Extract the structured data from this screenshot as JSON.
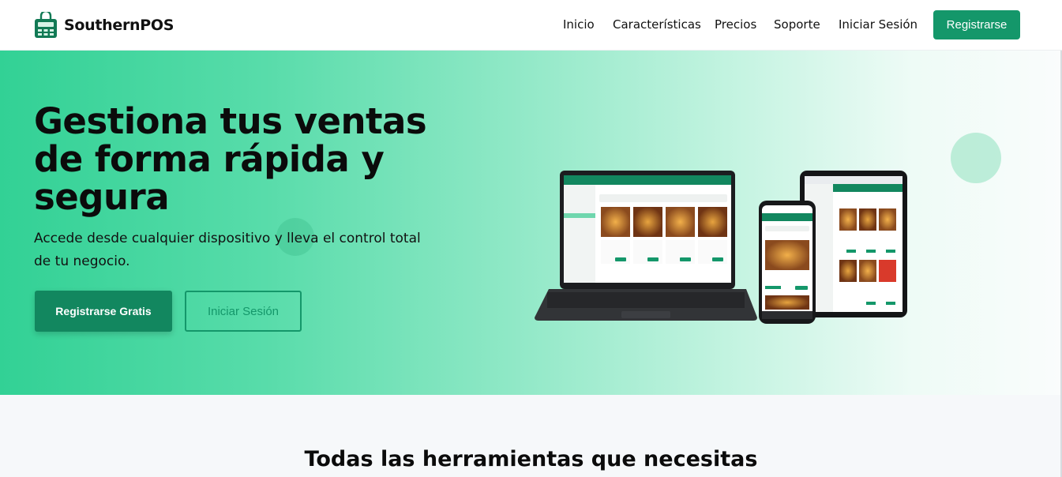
{
  "brand": {
    "name": "SouthernPOS",
    "logo_icon": "store-register-icon"
  },
  "nav": {
    "links": [
      "Inicio",
      "Características",
      "Precios",
      "Soporte",
      "Iniciar Sesión"
    ],
    "register_label": "Registrarse"
  },
  "hero": {
    "title": "Gestiona tus ventas de forma rápida y segura",
    "subtitle": "Accede desde cualquier dispositivo y lleva el control total de tu negocio.",
    "primary_button": "Registrarse Gratis",
    "secondary_button": "Iniciar Sesión",
    "image": "laptop-phone-tablet-pos-mockup"
  },
  "features": {
    "title": "Todas las herramientas que necesitas"
  },
  "colors": {
    "brand": "#14976a",
    "hero_start": "#32d195",
    "hero_end": "#fafcfc"
  }
}
